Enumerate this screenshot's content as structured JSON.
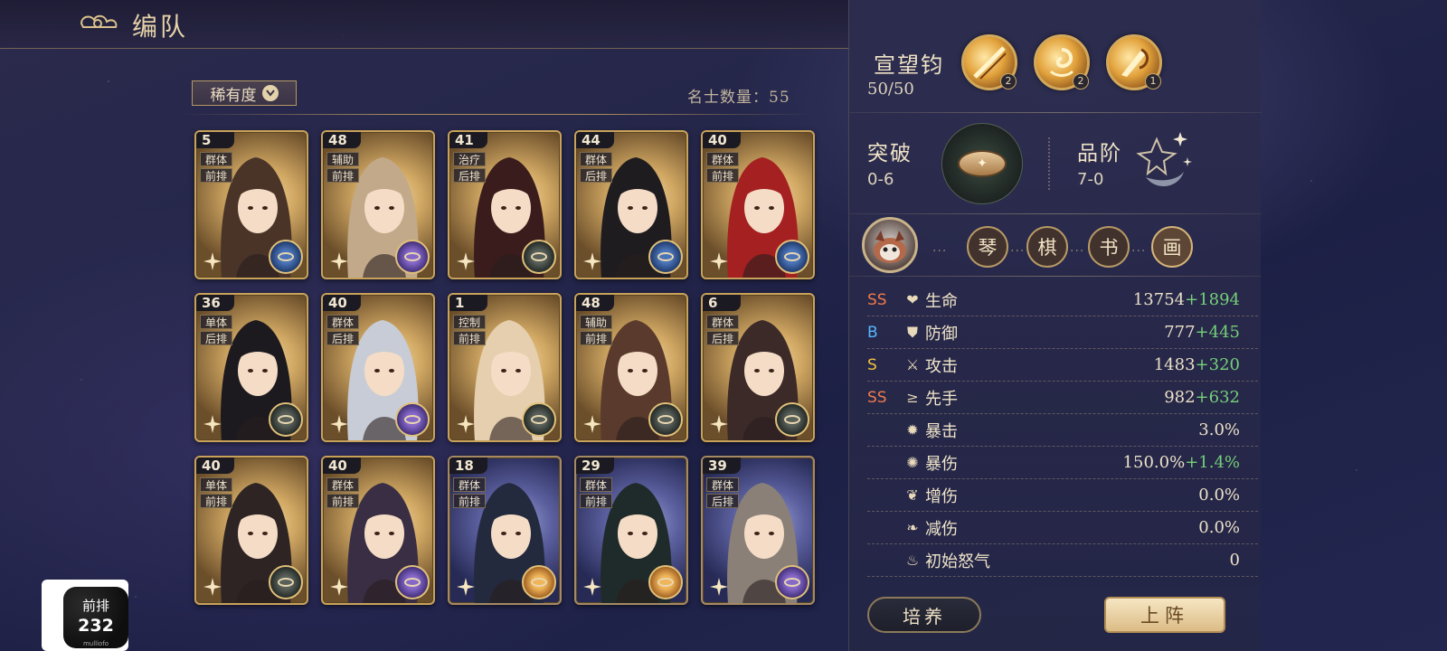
{
  "header": {
    "title": "编队"
  },
  "filter": {
    "label": "稀有度"
  },
  "roster": {
    "count_text": "名士数量：55"
  },
  "cards": [
    {
      "level": "5",
      "tags": [
        "群体",
        "前排"
      ],
      "frame": "gold",
      "badge": "blue"
    },
    {
      "level": "48",
      "tags": [
        "辅助",
        "前排"
      ],
      "frame": "gold",
      "badge": "purple"
    },
    {
      "level": "41",
      "tags": [
        "治疗",
        "后排"
      ],
      "frame": "gold",
      "badge": "dark"
    },
    {
      "level": "44",
      "tags": [
        "群体",
        "后排"
      ],
      "frame": "gold",
      "badge": "blue"
    },
    {
      "level": "40",
      "tags": [
        "群体",
        "前排"
      ],
      "frame": "gold",
      "badge": "blue"
    },
    {
      "level": "36",
      "tags": [
        "单体",
        "后排"
      ],
      "frame": "gold",
      "badge": "dark"
    },
    {
      "level": "40",
      "tags": [
        "群体",
        "后排"
      ],
      "frame": "gold",
      "badge": "purple"
    },
    {
      "level": "1",
      "tags": [
        "控制",
        "前排"
      ],
      "frame": "gold",
      "badge": "dark"
    },
    {
      "level": "48",
      "tags": [
        "辅助",
        "前排"
      ],
      "frame": "gold",
      "badge": "dark"
    },
    {
      "level": "6",
      "tags": [
        "群体",
        "后排"
      ],
      "frame": "gold",
      "badge": "dark"
    },
    {
      "level": "40",
      "tags": [
        "单体",
        "前排"
      ],
      "frame": "gold",
      "badge": "dark"
    },
    {
      "level": "40",
      "tags": [
        "群体",
        "前排"
      ],
      "frame": "gold",
      "badge": "purple"
    },
    {
      "level": "18",
      "tags": [
        "群体",
        "前排"
      ],
      "frame": "blue",
      "badge": "orange"
    },
    {
      "level": "29",
      "tags": [
        "群体",
        "前排"
      ],
      "frame": "blue",
      "badge": "orange"
    },
    {
      "level": "39",
      "tags": [
        "群体",
        "后排"
      ],
      "frame": "blue",
      "badge": "purple"
    }
  ],
  "hero": {
    "name": "宣望钧",
    "value": "50/50",
    "skills": [
      {
        "level": "2",
        "icon": "slash-skill-icon"
      },
      {
        "level": "2",
        "icon": "swirl-skill-icon"
      },
      {
        "level": "1",
        "icon": "strike-skill-icon"
      }
    ],
    "breakthrough": {
      "label": "突破",
      "value": "0-6"
    },
    "rank": {
      "label": "品阶",
      "value": "7-0"
    },
    "arts": [
      "琴",
      "棋",
      "书",
      "画"
    ],
    "arts_dots": "···",
    "stats": [
      {
        "grade": "SS",
        "grade_class": "grade-ss",
        "icon": "heart-icon",
        "name": "生命",
        "base": "13754",
        "bonus": "+1894"
      },
      {
        "grade": "B",
        "grade_class": "grade-b",
        "icon": "shield-icon",
        "name": "防御",
        "base": "777",
        "bonus": "+445"
      },
      {
        "grade": "S",
        "grade_class": "grade-s",
        "icon": "sword-icon",
        "name": "攻击",
        "base": "1483",
        "bonus": "+320"
      },
      {
        "grade": "SS",
        "grade_class": "grade-ss",
        "icon": "speed-icon",
        "name": "先手",
        "base": "982",
        "bonus": "+632"
      },
      {
        "grade": "",
        "grade_class": "",
        "icon": "crit-icon",
        "name": "暴击",
        "base": "3.0%",
        "bonus": ""
      },
      {
        "grade": "",
        "grade_class": "",
        "icon": "crit-damage-icon",
        "name": "暴伤",
        "base": "150.0%",
        "bonus": "+1.4%"
      },
      {
        "grade": "",
        "grade_class": "",
        "icon": "damage-boost-icon",
        "name": "增伤",
        "base": "0.0%",
        "bonus": ""
      },
      {
        "grade": "",
        "grade_class": "",
        "icon": "damage-reduction-icon",
        "name": "减伤",
        "base": "0.0%",
        "bonus": ""
      },
      {
        "grade": "",
        "grade_class": "",
        "icon": "rage-icon",
        "name": "初始怒气",
        "base": "0",
        "bonus": ""
      }
    ],
    "train_label": "培养",
    "deploy_label": "上阵"
  },
  "floating_widget": {
    "label": "前排",
    "value": "232",
    "footer": "mulliofo"
  },
  "colors": {
    "accent_gold": "#c9a25a",
    "bonus_green": "#76d07a",
    "grade_ss": "#f07a4a",
    "grade_s": "#f2c040",
    "grade_b": "#55b6ff"
  }
}
